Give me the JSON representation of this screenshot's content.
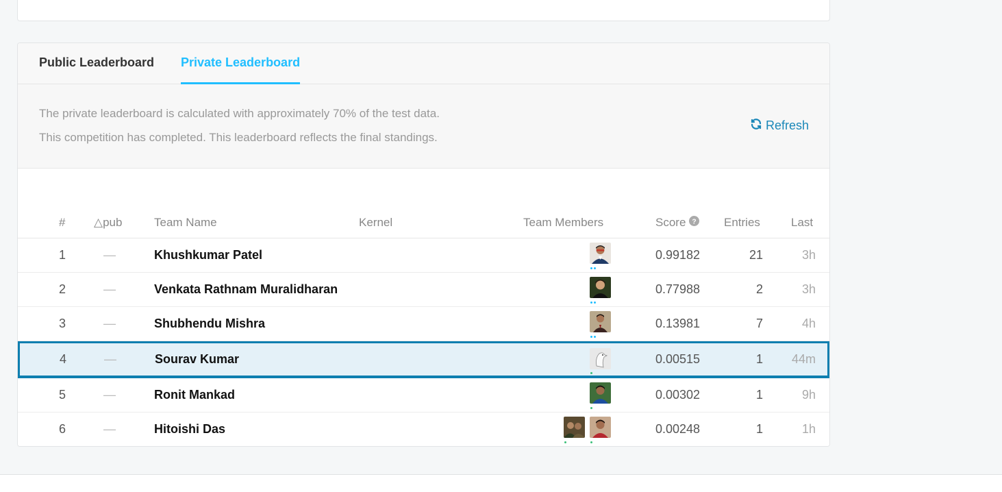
{
  "tabs": {
    "public": "Public Leaderboard",
    "private": "Private Leaderboard"
  },
  "info": {
    "line1": "The private leaderboard is calculated with approximately 70% of the test data.",
    "line2": "This competition has completed. This leaderboard reflects the final standings.",
    "refresh": "Refresh"
  },
  "headers": {
    "rank": "#",
    "delta": "△pub",
    "team_name": "Team Name",
    "kernel": "Kernel",
    "team_members": "Team Members",
    "score": "Score",
    "entries": "Entries",
    "last": "Last"
  },
  "rows": [
    {
      "rank": "1",
      "delta": "—",
      "team": "Khushkumar Patel",
      "score": "0.99182",
      "entries": "21",
      "last": "3h"
    },
    {
      "rank": "2",
      "delta": "—",
      "team": "Venkata Rathnam Muralidharan",
      "score": "0.77988",
      "entries": "2",
      "last": "3h"
    },
    {
      "rank": "3",
      "delta": "—",
      "team": "Shubhendu Mishra",
      "score": "0.13981",
      "entries": "7",
      "last": "4h"
    },
    {
      "rank": "4",
      "delta": "—",
      "team": "Sourav Kumar",
      "score": "0.00515",
      "entries": "1",
      "last": "44m"
    },
    {
      "rank": "5",
      "delta": "—",
      "team": "Ronit Mankad",
      "score": "0.00302",
      "entries": "1",
      "last": "9h"
    },
    {
      "rank": "6",
      "delta": "—",
      "team": "Hitoishi Das",
      "score": "0.00248",
      "entries": "1",
      "last": "1h"
    }
  ],
  "colors": {
    "accent": "#20beff",
    "highlight_border": "#0e7fb0",
    "highlight_bg": "#e4f1f8"
  }
}
